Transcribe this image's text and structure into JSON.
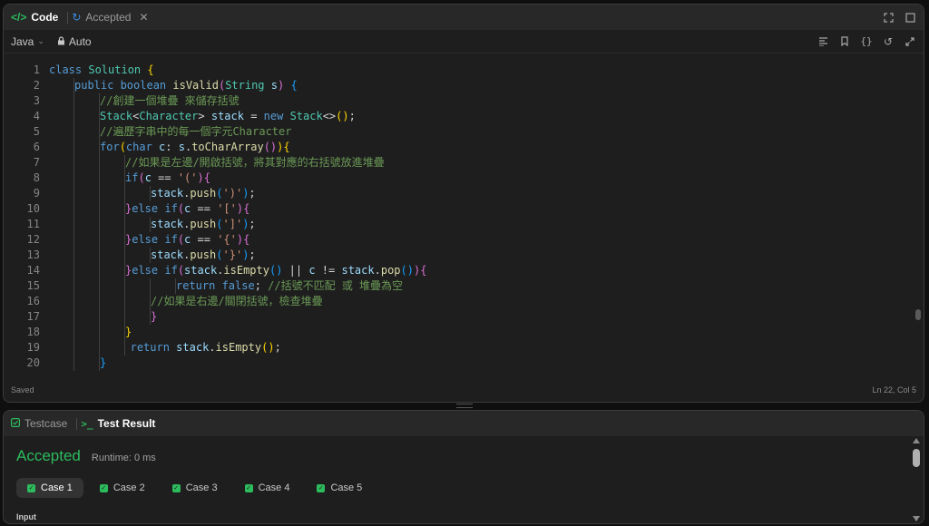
{
  "code_panel": {
    "tab_code": "Code",
    "tab_accepted": "Accepted",
    "language": "Java",
    "auto": "Auto",
    "saved": "Saved",
    "cursor": "Ln 22, Col 5"
  },
  "editor": {
    "lines": [
      {
        "n": "1",
        "indent": 0,
        "tokens": [
          [
            "kw",
            "class "
          ],
          [
            "ty",
            "Solution "
          ],
          [
            "br1",
            "{"
          ]
        ]
      },
      {
        "n": "2",
        "indent": 1,
        "tokens": [
          [
            "kw",
            "public boolean "
          ],
          [
            "fn",
            "isValid"
          ],
          [
            "br2",
            "("
          ],
          [
            "ty",
            "String "
          ],
          [
            "vr",
            "s"
          ],
          [
            "br2",
            ")"
          ],
          [
            "pc",
            " "
          ],
          [
            "br3",
            "{"
          ]
        ]
      },
      {
        "n": "3",
        "indent": 2,
        "tokens": [
          [
            "cm",
            "//創建一個堆疊 來儲存括號"
          ]
        ]
      },
      {
        "n": "4",
        "indent": 2,
        "tokens": [
          [
            "ty",
            "Stack"
          ],
          [
            "pc",
            "<"
          ],
          [
            "ty",
            "Character"
          ],
          [
            "pc",
            "> "
          ],
          [
            "vr",
            "stack"
          ],
          [
            "pc",
            " = "
          ],
          [
            "kw",
            "new "
          ],
          [
            "ty",
            "Stack"
          ],
          [
            "pc",
            "<>"
          ],
          [
            "br1",
            "()"
          ],
          [
            "pc",
            ";"
          ]
        ]
      },
      {
        "n": "5",
        "indent": 2,
        "tokens": [
          [
            "cm",
            "//遍歷字串中的每一個字元Character"
          ]
        ]
      },
      {
        "n": "6",
        "indent": 2,
        "tokens": [
          [
            "kw",
            "for"
          ],
          [
            "br1",
            "("
          ],
          [
            "kw",
            "char "
          ],
          [
            "vr",
            "c"
          ],
          [
            "pc",
            ": "
          ],
          [
            "vr",
            "s"
          ],
          [
            "pc",
            "."
          ],
          [
            "fn",
            "toCharArray"
          ],
          [
            "br2",
            "()"
          ],
          [
            "br1",
            ")"
          ],
          [
            "br1",
            "{"
          ]
        ]
      },
      {
        "n": "7",
        "indent": 3,
        "tokens": [
          [
            "cm",
            "//如果是左邊/開啟括號，將其對應的右括號放進堆疊"
          ]
        ]
      },
      {
        "n": "8",
        "indent": 3,
        "tokens": [
          [
            "kw",
            "if"
          ],
          [
            "br2",
            "("
          ],
          [
            "vr",
            "c"
          ],
          [
            "pc",
            " == "
          ],
          [
            "st",
            "'('"
          ],
          [
            "br2",
            ")"
          ],
          [
            "br2",
            "{"
          ]
        ]
      },
      {
        "n": "9",
        "indent": 4,
        "tokens": [
          [
            "vr",
            "stack"
          ],
          [
            "pc",
            "."
          ],
          [
            "fn",
            "push"
          ],
          [
            "br3",
            "("
          ],
          [
            "st",
            "')'"
          ],
          [
            "br3",
            ")"
          ],
          [
            "pc",
            ";"
          ]
        ]
      },
      {
        "n": "10",
        "indent": 3,
        "tokens": [
          [
            "br2",
            "}"
          ],
          [
            "kw",
            "else if"
          ],
          [
            "br2",
            "("
          ],
          [
            "vr",
            "c"
          ],
          [
            "pc",
            " == "
          ],
          [
            "st",
            "'['"
          ],
          [
            "br2",
            ")"
          ],
          [
            "br2",
            "{"
          ]
        ]
      },
      {
        "n": "11",
        "indent": 4,
        "tokens": [
          [
            "vr",
            "stack"
          ],
          [
            "pc",
            "."
          ],
          [
            "fn",
            "push"
          ],
          [
            "br3",
            "("
          ],
          [
            "st",
            "']'"
          ],
          [
            "br3",
            ")"
          ],
          [
            "pc",
            ";"
          ]
        ]
      },
      {
        "n": "12",
        "indent": 3,
        "tokens": [
          [
            "br2",
            "}"
          ],
          [
            "kw",
            "else if"
          ],
          [
            "br2",
            "("
          ],
          [
            "vr",
            "c"
          ],
          [
            "pc",
            " == "
          ],
          [
            "st",
            "'{'"
          ],
          [
            "br2",
            ")"
          ],
          [
            "br2",
            "{"
          ]
        ]
      },
      {
        "n": "13",
        "indent": 4,
        "tokens": [
          [
            "vr",
            "stack"
          ],
          [
            "pc",
            "."
          ],
          [
            "fn",
            "push"
          ],
          [
            "br3",
            "("
          ],
          [
            "st",
            "'}'"
          ],
          [
            "br3",
            ")"
          ],
          [
            "pc",
            ";"
          ]
        ]
      },
      {
        "n": "14",
        "indent": 3,
        "tokens": [
          [
            "br2",
            "}"
          ],
          [
            "kw",
            "else if"
          ],
          [
            "br2",
            "("
          ],
          [
            "vr",
            "stack"
          ],
          [
            "pc",
            "."
          ],
          [
            "fn",
            "isEmpty"
          ],
          [
            "br3",
            "()"
          ],
          [
            "pc",
            " || "
          ],
          [
            "vr",
            "c"
          ],
          [
            "pc",
            " != "
          ],
          [
            "vr",
            "stack"
          ],
          [
            "pc",
            "."
          ],
          [
            "fn",
            "pop"
          ],
          [
            "br3",
            "()"
          ],
          [
            "br2",
            ")"
          ],
          [
            "br2",
            "{"
          ]
        ]
      },
      {
        "n": "15",
        "indent": 5,
        "tokens": [
          [
            "kw",
            "return false"
          ],
          [
            "pc",
            "; "
          ],
          [
            "cm",
            "//括號不匹配 或 堆疊為空"
          ]
        ]
      },
      {
        "n": "16",
        "indent": 4,
        "tokens": [
          [
            "cm",
            "//如果是右邊/關閉括號，檢查堆疊"
          ]
        ]
      },
      {
        "n": "17",
        "indent": 4,
        "tokens": [
          [
            "br2",
            "}"
          ]
        ]
      },
      {
        "n": "18",
        "indent": 3,
        "tokens": [
          [
            "br1",
            "}"
          ]
        ]
      },
      {
        "n": "19",
        "indent": 3.2,
        "tokens": [
          [
            "kw",
            "return "
          ],
          [
            "vr",
            "stack"
          ],
          [
            "pc",
            "."
          ],
          [
            "fn",
            "isEmpty"
          ],
          [
            "br1",
            "()"
          ],
          [
            "pc",
            ";"
          ]
        ]
      },
      {
        "n": "20",
        "indent": 2,
        "tokens": [
          [
            "br3",
            "}"
          ]
        ]
      }
    ]
  },
  "result_panel": {
    "tab_testcase": "Testcase",
    "tab_result": "Test Result",
    "status": "Accepted",
    "runtime": "Runtime: 0 ms",
    "cases": [
      "Case 1",
      "Case 2",
      "Case 3",
      "Case 4",
      "Case 5"
    ],
    "input_label": "Input"
  },
  "colors": {
    "accepted": "#2cbb5d",
    "keyword": "#569cd6",
    "type": "#4ec9b0",
    "comment": "#6a9955"
  },
  "icons": [
    "code-icon",
    "history-icon",
    "close-icon",
    "fullscreen-icon",
    "maximize-icon",
    "chevron-down-icon",
    "lock-icon",
    "format-icon",
    "bookmark-icon",
    "braces-icon",
    "reset-icon",
    "expand-icon",
    "checkbox-icon",
    "terminal-icon",
    "check-icon"
  ]
}
